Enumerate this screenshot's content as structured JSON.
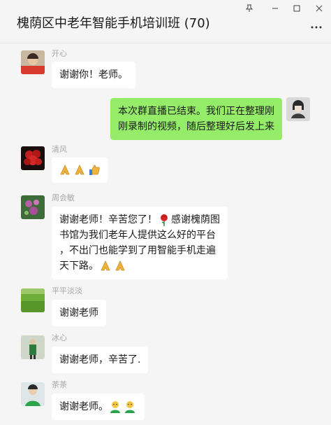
{
  "window": {
    "title": "槐荫区中老年智能手机培训班 (70)",
    "controls": [
      "pin-icon",
      "minimize-icon",
      "maximize-icon",
      "close-icon"
    ],
    "more_icon": "ellipsis-icon"
  },
  "messages": [
    {
      "sender": "开心",
      "lines": [
        "谢谢你！老师。"
      ],
      "emojis_after": []
    },
    {
      "sender": "",
      "self": true,
      "lines": [
        "本次群直播已结束。我们正在整理刚",
        "刚录制的视频，随后整理好后发上来"
      ],
      "emojis_after": []
    },
    {
      "sender": "清风",
      "lines": [],
      "emojis_after": [
        "pray-hands-icon",
        "pray-hands-icon",
        "thumbs-up-icon"
      ]
    },
    {
      "sender": "周会敏",
      "lines": [
        "谢谢老师！辛苦您了！",
        "书馆为我们老年人提供这么好的平台",
        "，不出门也能学到了用智能手机走遍",
        "天下路。"
      ],
      "line1_tail": "感谢槐荫图",
      "emojis_inline": [
        "rose-icon"
      ],
      "emojis_after": [
        "pray-hands-icon",
        "pray-hands-icon"
      ]
    },
    {
      "sender": "平平淡淡",
      "lines": [
        "谢谢老师"
      ],
      "emojis_after": []
    },
    {
      "sender": "冰心",
      "lines": [
        "谢谢老师，辛苦了."
      ],
      "emojis_after": []
    },
    {
      "sender": "茶茶",
      "lines": [
        "谢谢老师。"
      ],
      "emojis_after": [
        "green-emoji-person-icon",
        "green-emoji-person-icon"
      ]
    }
  ],
  "colors": {
    "background": "#f5f5f5",
    "bubble_other": "#ffffff",
    "bubble_self": "#95ec69",
    "sender_name": "#a8a8a8"
  }
}
